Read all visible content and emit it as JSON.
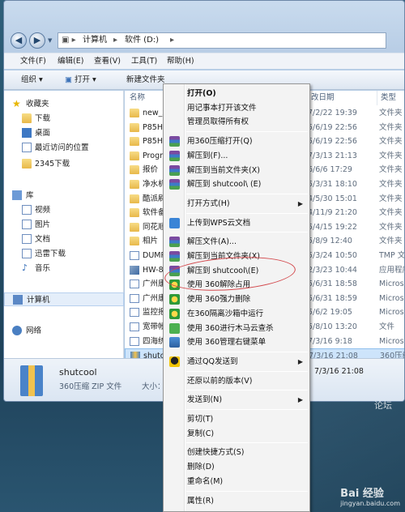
{
  "address": {
    "computer": "计算机",
    "drive": "软件 (D:)"
  },
  "menu": [
    "文件(F)",
    "编辑(E)",
    "查看(V)",
    "工具(T)",
    "帮助(H)"
  ],
  "toolbar": {
    "organize": "组织",
    "open": "打开",
    "new_folder": "新建文件夹"
  },
  "nav": {
    "favorites": "收藏夹",
    "fav_items": [
      "下载",
      "桌面",
      "最近访问的位置",
      "2345下载"
    ],
    "libraries": "库",
    "lib_items": [
      "视频",
      "图片",
      "文档",
      "迅雷下载",
      "音乐"
    ],
    "computer": "计算机",
    "network": "网络"
  },
  "columns": {
    "name": "名称",
    "date": "改日期",
    "type": "类型"
  },
  "files": [
    {
      "name": "new_xe",
      "date": "7/2/22 19:39",
      "type": "文件夹"
    },
    {
      "name": "P85HD",
      "date": "5/6/19 22:56",
      "type": "文件夹"
    },
    {
      "name": "P85HD",
      "date": "5/6/19 22:56",
      "type": "文件夹"
    },
    {
      "name": "Progra",
      "date": "7/3/13 21:13",
      "type": "文件夹"
    },
    {
      "name": "报价",
      "date": "6/6/6 17:29",
      "type": "文件夹"
    },
    {
      "name": "净水机",
      "date": "5/3/31 18:10",
      "type": "文件夹"
    },
    {
      "name": "酷派刷",
      "date": "4/5/30 15:01",
      "type": "文件夹"
    },
    {
      "name": "软件备",
      "date": "4/11/9 21:20",
      "type": "文件夹"
    },
    {
      "name": "同花顺",
      "date": "5/4/15 19:22",
      "type": "文件夹"
    },
    {
      "name": "相片",
      "date": "5/8/9 12:40",
      "type": "文件夹"
    },
    {
      "name": "DUMP",
      "date": "5/3/24 10:50",
      "type": "TMP 文件"
    },
    {
      "name": "HW-8",
      "date": "2/3/23 10:44",
      "type": "应用程序"
    },
    {
      "name": "广州康",
      "date": "5/6/31 18:58",
      "type": "Microso"
    },
    {
      "name": "广州康",
      "date": "5/6/31 18:59",
      "type": "Microso"
    },
    {
      "name": "监控报",
      "date": "5/6/2 19:05",
      "type": "Microso"
    },
    {
      "name": "宽带帐",
      "date": "5/8/10 13:20",
      "type": "文件"
    },
    {
      "name": "四海统",
      "date": "7/3/16 9:18",
      "type": "Microso"
    },
    {
      "name": "shutco",
      "date": "7/3/16 21:08",
      "type": "360压缩"
    }
  ],
  "details": {
    "name": "shutcool",
    "type": "360压缩 ZIP 文件",
    "size_label": "大小：",
    "date": "7/3/16 21:08"
  },
  "context_menu": [
    {
      "label": "打开(O)",
      "bold": true
    },
    {
      "label": "用记事本打开该文件"
    },
    {
      "label": "管理员取得所有权"
    },
    {
      "sep": true
    },
    {
      "label": "用360压缩打开(Q)",
      "icon": "360-zip-icon"
    },
    {
      "label": "解压到(F)...",
      "icon": "360-zip-icon"
    },
    {
      "label": "解压到当前文件夹(X)",
      "icon": "360-zip-icon"
    },
    {
      "label": "解压到 shutcool\\ (E)",
      "icon": "360-zip-icon"
    },
    {
      "sep": true
    },
    {
      "label": "打开方式(H)",
      "submenu": true
    },
    {
      "sep": true
    },
    {
      "label": "上传到WPS云文档",
      "icon": "wps-cloud-icon"
    },
    {
      "sep": true
    },
    {
      "label": "解压文件(A)...",
      "icon": "winrar-icon"
    },
    {
      "label": "解压到当前文件夹(X)",
      "icon": "winrar-icon"
    },
    {
      "label": "解压到 shutcool\\(E)",
      "icon": "winrar-icon"
    },
    {
      "label": "使用 360解除占用",
      "icon": "360-icon"
    },
    {
      "label": "使用 360强力删除",
      "icon": "360-icon"
    },
    {
      "label": "在360隔离沙箱中运行",
      "icon": "360-icon"
    },
    {
      "label": "使用 360进行木马云查杀",
      "icon": "360-icon"
    },
    {
      "label": "使用 360管理右键菜单",
      "icon": "360-icon"
    },
    {
      "sep": true
    },
    {
      "label": "通过QQ发送到",
      "icon": "qq-icon",
      "submenu": true
    },
    {
      "sep": true
    },
    {
      "label": "还原以前的版本(V)"
    },
    {
      "sep": true
    },
    {
      "label": "发送到(N)",
      "submenu": true
    },
    {
      "sep": true
    },
    {
      "label": "剪切(T)"
    },
    {
      "label": "复制(C)"
    },
    {
      "sep": true
    },
    {
      "label": "创建快捷方式(S)"
    },
    {
      "label": "删除(D)"
    },
    {
      "label": "重命名(M)"
    },
    {
      "sep": true
    },
    {
      "label": "属性(R)"
    }
  ],
  "watermark": {
    "site": "jingyan.baidu.com",
    "brand": "Bai 经验"
  },
  "forum": "论坛"
}
